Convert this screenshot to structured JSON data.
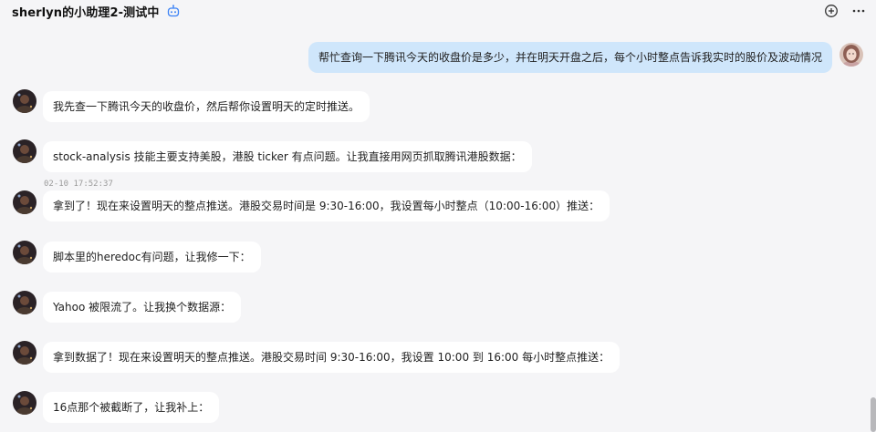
{
  "header": {
    "title": "sherlyn的小助理2-测试中",
    "icons": [
      "bot-badge-icon",
      "add-circle-icon",
      "more-icon"
    ]
  },
  "messages": [
    {
      "role": "user",
      "text": "帮忙查询一下腾讯今天的收盘价是多少，并在明天开盘之后，每个小时整点告诉我实时的股价及波动情况"
    },
    {
      "role": "assistant",
      "text": "我先查一下腾讯今天的收盘价，然后帮你设置明天的定时推送。"
    },
    {
      "role": "assistant",
      "text": "stock-analysis 技能主要支持美股，港股 ticker 有点问题。让我直接用网页抓取腾讯港股数据："
    },
    {
      "role": "assistant",
      "timestamp": "02-10 17:52:37",
      "text": "拿到了！现在来设置明天的整点推送。港股交易时间是 9:30-16:00，我设置每小时整点（10:00-16:00）推送："
    },
    {
      "role": "assistant",
      "text": "脚本里的heredoc有问题，让我修一下："
    },
    {
      "role": "assistant",
      "text": "Yahoo 被限流了。让我换个数据源："
    },
    {
      "role": "assistant",
      "text": "拿到数据了！现在来设置明天的整点推送。港股交易时间 9:30-16:00，我设置 10:00 到 16:00 每小时整点推送："
    },
    {
      "role": "assistant",
      "text": "16点那个被截断了，让我补上："
    }
  ],
  "colors": {
    "background": "#f5f5f7",
    "user_bubble": "#cfe6fb",
    "assistant_bubble": "#ffffff",
    "accent": "#3b82f6"
  }
}
